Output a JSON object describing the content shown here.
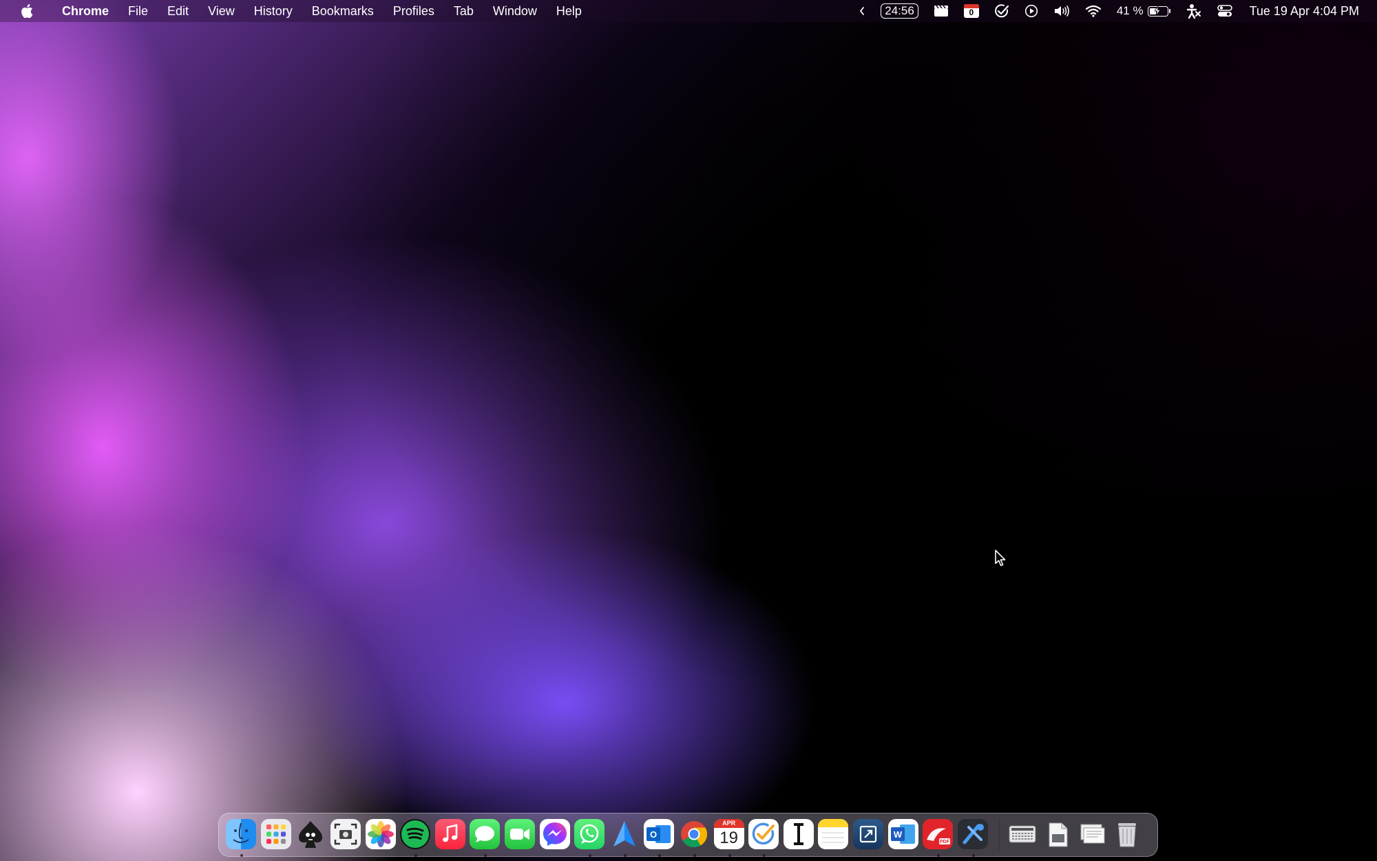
{
  "menubar": {
    "app_name": "Chrome",
    "menus": [
      "File",
      "Edit",
      "View",
      "History",
      "Bookmarks",
      "Profiles",
      "Tab",
      "Window",
      "Help"
    ],
    "status": {
      "timer": "24:56",
      "calendar_badge": "0",
      "battery_percent_label": "41 %",
      "battery_level": 0.41,
      "datetime": "Tue 19 Apr  4:04 PM"
    }
  },
  "dock": {
    "calendar_icon": {
      "month": "APR",
      "day": "19"
    },
    "apps": [
      {
        "name": "Finder",
        "icon": "finder-icon",
        "running": true
      },
      {
        "name": "Launchpad",
        "icon": "launchpad-icon",
        "running": false
      },
      {
        "name": "Solitaire",
        "icon": "spade-skull-icon",
        "running": false
      },
      {
        "name": "Screenshot",
        "icon": "screenshot-icon",
        "running": false
      },
      {
        "name": "Photos",
        "icon": "photos-icon",
        "running": false
      },
      {
        "name": "Spotify",
        "icon": "spotify-icon",
        "running": true
      },
      {
        "name": "Music",
        "icon": "music-icon",
        "running": false
      },
      {
        "name": "Messages",
        "icon": "messages-icon",
        "running": true
      },
      {
        "name": "FaceTime",
        "icon": "facetime-icon",
        "running": false
      },
      {
        "name": "Messenger",
        "icon": "messenger-icon",
        "running": false
      },
      {
        "name": "WhatsApp",
        "icon": "whatsapp-icon",
        "running": true
      },
      {
        "name": "Spark",
        "icon": "paper-plane-icon",
        "running": true
      },
      {
        "name": "Outlook",
        "icon": "outlook-icon",
        "running": true
      },
      {
        "name": "Chrome",
        "icon": "chrome-icon",
        "running": true
      },
      {
        "name": "Calendar",
        "icon": "calendar-icon",
        "running": true
      },
      {
        "name": "Tasks",
        "icon": "checkmark-icon",
        "running": true
      },
      {
        "name": "Typora",
        "icon": "text-cursor-icon",
        "running": false
      },
      {
        "name": "Notes",
        "icon": "notes-icon",
        "running": false
      },
      {
        "name": "Preview",
        "icon": "preview-icon",
        "running": false
      },
      {
        "name": "Word",
        "icon": "word-icon",
        "running": false
      },
      {
        "name": "PDF Reader",
        "icon": "pdf-icon",
        "running": true
      },
      {
        "name": "Xcode",
        "icon": "xcode-icon",
        "running": true
      }
    ],
    "folders": [
      {
        "name": "Keyboard Viewer",
        "icon": "keyboard-icon"
      },
      {
        "name": "Documents",
        "icon": "documents-icon"
      },
      {
        "name": "Downloads",
        "icon": "downloads-stack-icon"
      },
      {
        "name": "Trash",
        "icon": "trash-icon"
      }
    ]
  },
  "colors": {
    "spotify": "#1db954",
    "music": "#fa3c4c",
    "messages": "#32d74b",
    "whatsapp": "#25d366",
    "outlook": "#0a64c8",
    "word": "#1d5bbf",
    "pdf": "#e0242a",
    "calendar_red": "#e0342a"
  }
}
